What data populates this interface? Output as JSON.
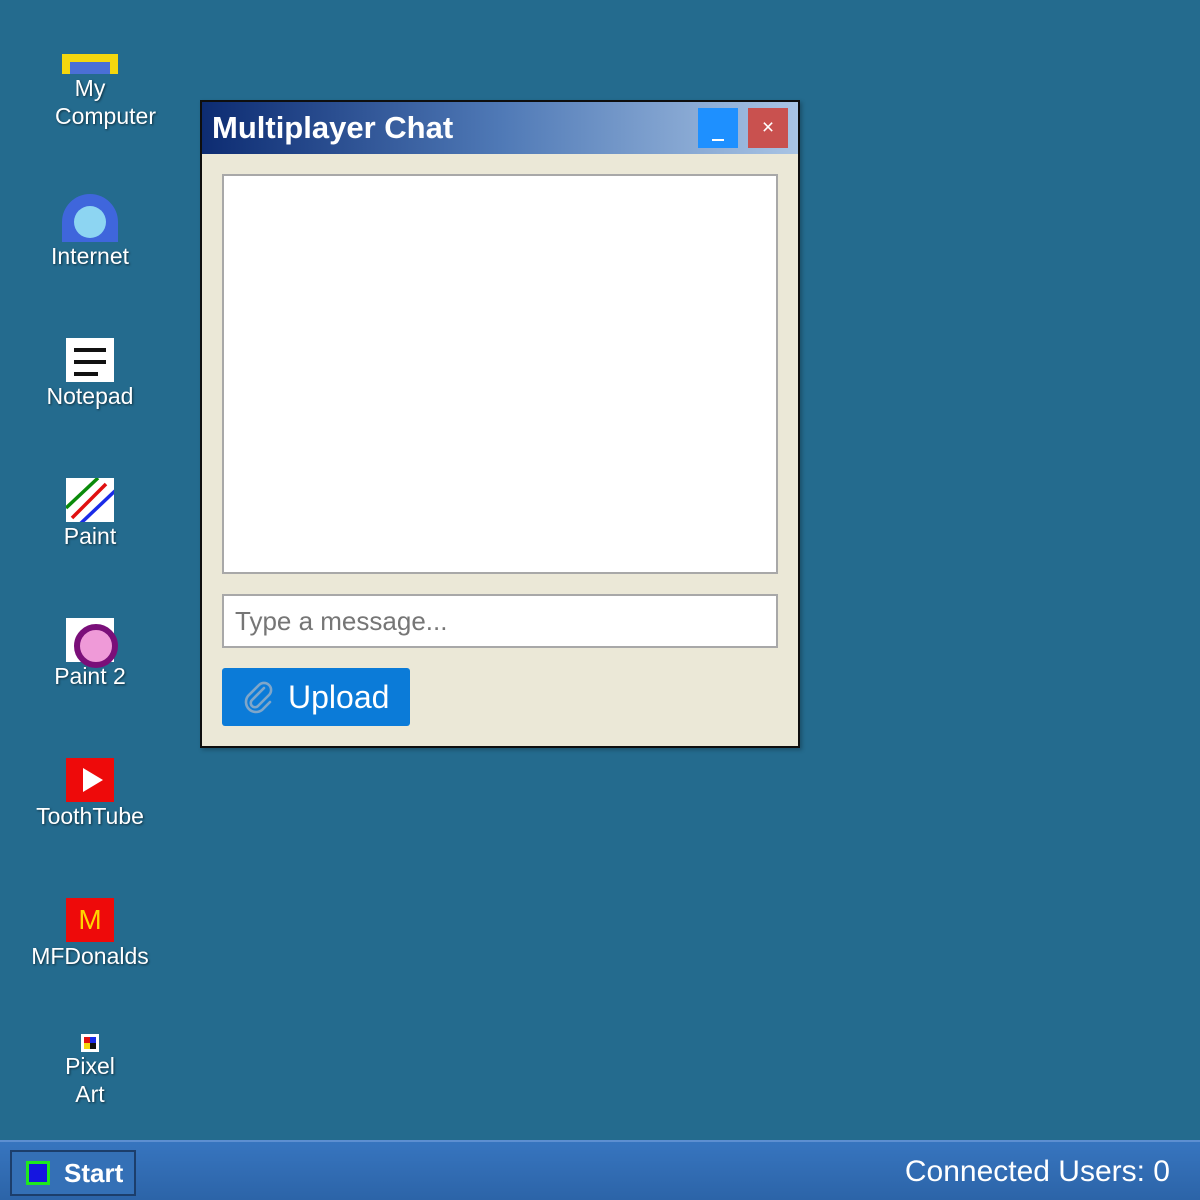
{
  "desktop_icons": [
    {
      "label": "My Computer",
      "icon": "computer-icon"
    },
    {
      "label": "Internet",
      "icon": "globe-icon"
    },
    {
      "label": "Notepad",
      "icon": "notepad-icon"
    },
    {
      "label": "Paint",
      "icon": "paint-icon"
    },
    {
      "label": "Paint 2",
      "icon": "paint2-icon"
    },
    {
      "label": "ToothTube",
      "icon": "play-icon"
    },
    {
      "label": "MFDonalds",
      "icon": "mfdonalds-icon",
      "glyph_text": "M"
    },
    {
      "label": "Pixel Art",
      "icon": "pixel-art-icon"
    }
  ],
  "chat_window": {
    "title": "Multiplayer Chat",
    "minimize_label": "_",
    "close_label": "×",
    "message_input": {
      "value": "",
      "placeholder": "Type a message..."
    },
    "upload_label": "Upload",
    "messages": []
  },
  "taskbar": {
    "start_label": "Start",
    "connected_users_text": "Connected Users: 0"
  },
  "colors": {
    "desktop_background": "#246b8e",
    "window_body": "#ebe8d7",
    "title_gradient_start": "#0d2c72",
    "title_gradient_end": "#a9c4e4",
    "minimize_button": "#1e90ff",
    "close_button": "#c9514f",
    "upload_button": "#0b7bd8",
    "taskbar": "#2c64a8"
  }
}
